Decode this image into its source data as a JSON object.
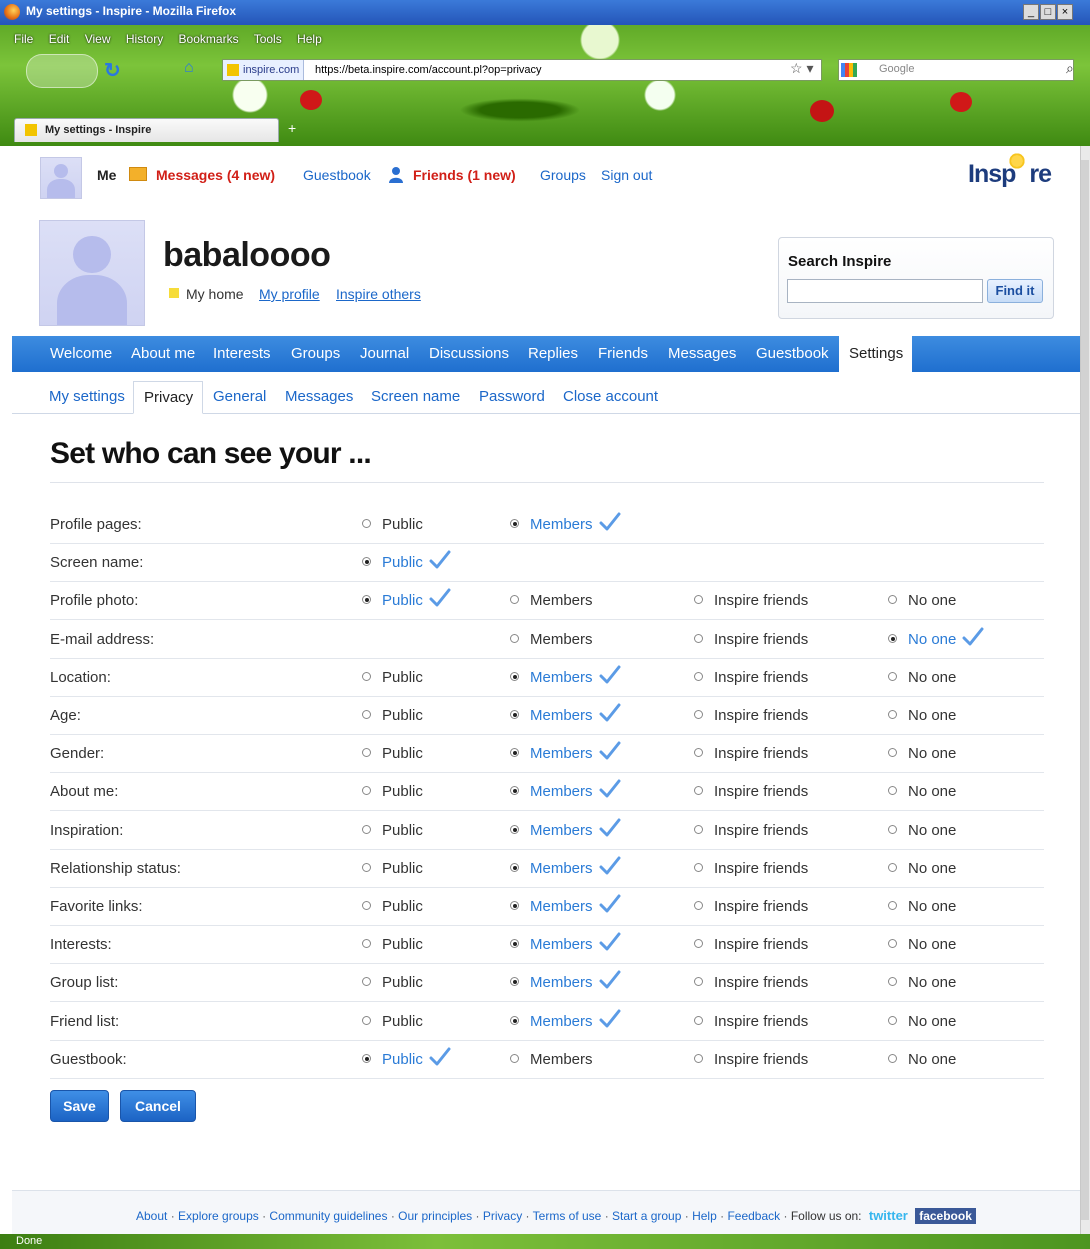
{
  "browser": {
    "window_title": "My settings - Inspire - Mozilla Firefox",
    "menu": [
      "File",
      "Edit",
      "View",
      "History",
      "Bookmarks",
      "Tools",
      "Help"
    ],
    "site_badge": "inspire.com",
    "url": "https://beta.inspire.com/account.pl?op=privacy",
    "search_engine": "Google",
    "tab_title": "My settings - Inspire",
    "status_text": "Done"
  },
  "nav": {
    "me": "Me",
    "messages": "Messages (4 new)",
    "guestbook": "Guestbook",
    "friends": "Friends (1 new)",
    "groups": "Groups",
    "signout": "Sign out",
    "logo_left": "Insp",
    "logo_right": "re"
  },
  "profile": {
    "username": "babaloooo",
    "my_home": "My home",
    "my_profile": "My profile",
    "inspire_others": "Inspire others"
  },
  "search": {
    "title": "Search Inspire",
    "button": "Find it",
    "value": ""
  },
  "main_tabs": [
    "Welcome",
    "About me",
    "Interests",
    "Groups",
    "Journal",
    "Discussions",
    "Replies",
    "Friends",
    "Messages",
    "Guestbook",
    "Settings"
  ],
  "active_main_tab": "Settings",
  "sub_tabs": [
    "My settings",
    "Privacy",
    "General",
    "Messages",
    "Screen name",
    "Password",
    "Close account"
  ],
  "active_sub_tab": "Privacy",
  "heading": "Set who can see your ...",
  "option_labels": {
    "public": "Public",
    "members": "Members",
    "friends": "Inspire friends",
    "noone": "No one"
  },
  "rows": [
    {
      "label": "Profile pages:",
      "options": [
        "public",
        "members"
      ],
      "selected": "members"
    },
    {
      "label": "Screen name:",
      "options": [
        "public"
      ],
      "selected": "public"
    },
    {
      "label": "Profile photo:",
      "options": [
        "public",
        "members",
        "friends",
        "noone"
      ],
      "selected": "public"
    },
    {
      "label": "E-mail address:",
      "options": [
        "members",
        "friends",
        "noone"
      ],
      "selected": "noone"
    },
    {
      "label": "Location:",
      "options": [
        "public",
        "members",
        "friends",
        "noone"
      ],
      "selected": "members"
    },
    {
      "label": "Age:",
      "options": [
        "public",
        "members",
        "friends",
        "noone"
      ],
      "selected": "members"
    },
    {
      "label": "Gender:",
      "options": [
        "public",
        "members",
        "friends",
        "noone"
      ],
      "selected": "members"
    },
    {
      "label": "About me:",
      "options": [
        "public",
        "members",
        "friends",
        "noone"
      ],
      "selected": "members"
    },
    {
      "label": "Inspiration:",
      "options": [
        "public",
        "members",
        "friends",
        "noone"
      ],
      "selected": "members"
    },
    {
      "label": "Relationship status:",
      "options": [
        "public",
        "members",
        "friends",
        "noone"
      ],
      "selected": "members"
    },
    {
      "label": "Favorite links:",
      "options": [
        "public",
        "members",
        "friends",
        "noone"
      ],
      "selected": "members"
    },
    {
      "label": "Interests:",
      "options": [
        "public",
        "members",
        "friends",
        "noone"
      ],
      "selected": "members"
    },
    {
      "label": "Group list:",
      "options": [
        "public",
        "members",
        "friends",
        "noone"
      ],
      "selected": "members"
    },
    {
      "label": "Friend list:",
      "options": [
        "public",
        "members",
        "friends",
        "noone"
      ],
      "selected": "members"
    },
    {
      "label": "Guestbook:",
      "options": [
        "public",
        "members",
        "friends",
        "noone"
      ],
      "selected": "public"
    }
  ],
  "buttons": {
    "save": "Save",
    "cancel": "Cancel"
  },
  "footer": {
    "links": [
      "About",
      "Explore groups",
      "Community guidelines",
      "Our principles",
      "Privacy",
      "Terms of use",
      "Start a group",
      "Help",
      "Feedback"
    ],
    "follow": "Follow us on:",
    "twitter": "twitter",
    "facebook": "facebook"
  },
  "colors": {
    "accent": "#1f6fcf",
    "link": "#1b67c9",
    "alert": "#d11f17",
    "selected_option": "#2a7bd6"
  }
}
